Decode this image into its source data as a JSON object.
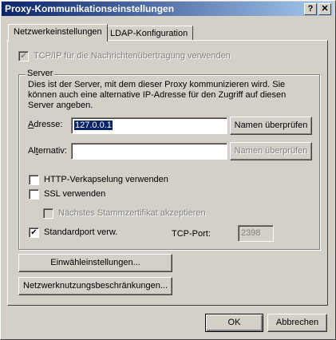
{
  "window": {
    "title": "Proxy-Kommunikationseinstellungen",
    "help_glyph": "?",
    "close_glyph": "✕"
  },
  "tabs": [
    {
      "label": "Netzwerkeinstellungen",
      "active": true
    },
    {
      "label": "LDAP-Konfiguration",
      "active": false
    }
  ],
  "tcpip": {
    "label": "TCP/IP für die Nachrichtenübertragung verwenden",
    "checked": true,
    "enabled": false
  },
  "server": {
    "legend": "Server",
    "description": "Dies ist der Server, mit dem dieser Proxy kommunizieren wird. Sie können auch eine alternative IP-Adresse für den Zugriff auf diesen Server angeben.",
    "address_label": "Adresse:",
    "address_value": "127.0.0.1",
    "alternative_label": "Alternativ:",
    "alternative_value": "",
    "check_names_label": "Namen überprüfen",
    "check_names_alt_label": "Namen überprüfen",
    "http_encap_label": "HTTP-Verkapselung verwenden",
    "ssl_label": "SSL verwenden",
    "root_cert_label": "Nächstes Stammzertifikat akzeptieren",
    "default_port_label": "Standardport verw.",
    "tcp_port_label": "TCP-Port:",
    "tcp_port_value": "2398",
    "checkmark": "✔"
  },
  "buttons": {
    "dialin": "Einwähleinstellungen...",
    "network_limits": "Netzwerknutzungsbeschränkungen...",
    "ok": "OK",
    "cancel": "Abbrechen"
  }
}
